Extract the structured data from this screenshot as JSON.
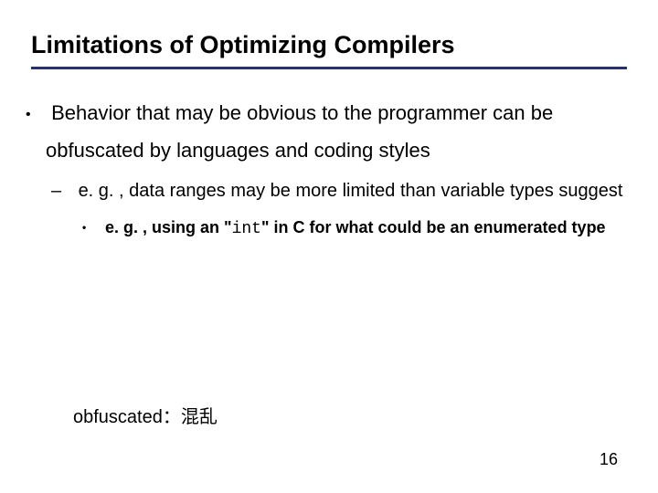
{
  "title": "Limitations of Optimizing Compilers",
  "bullet1": "Behavior that may be obvious to the programmer can be obfuscated by languages and coding styles",
  "sub1": "e. g. , data ranges may be more limited than variable types suggest",
  "subsub_pre": "e. g. , using an \"",
  "subsub_code": "int",
  "subsub_post": "\" in C for what could be an enumerated type",
  "note": "obfuscated：混乱",
  "page": "16"
}
